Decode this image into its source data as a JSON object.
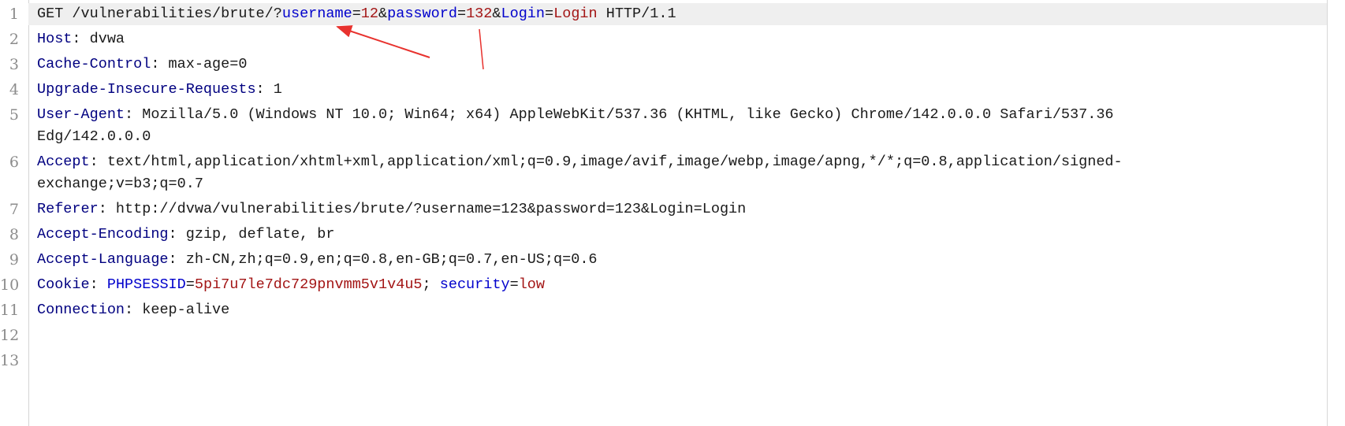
{
  "colors": {
    "header_name": "#000080",
    "param_name": "#0000cc",
    "param_value": "#a31515",
    "text": "#1a1a1a",
    "annotation": "#e8322e"
  },
  "active_line": 1,
  "lines": [
    {
      "n": "1",
      "segs": [
        [
          "t",
          "GET /vulnerabilities/brute/?"
        ],
        [
          "p",
          "username"
        ],
        [
          "t",
          "="
        ],
        [
          "v",
          "12"
        ],
        [
          "t",
          "&"
        ],
        [
          "p",
          "password"
        ],
        [
          "t",
          "="
        ],
        [
          "v",
          "132"
        ],
        [
          "t",
          "&"
        ],
        [
          "p",
          "Login"
        ],
        [
          "t",
          "="
        ],
        [
          "v",
          "Login"
        ],
        [
          "t",
          " HTTP/1.1"
        ]
      ]
    },
    {
      "n": "2",
      "segs": [
        [
          "k",
          "Host"
        ],
        [
          "t",
          ": dvwa"
        ]
      ]
    },
    {
      "n": "3",
      "segs": [
        [
          "k",
          "Cache-Control"
        ],
        [
          "t",
          ": max-age=0"
        ]
      ]
    },
    {
      "n": "4",
      "segs": [
        [
          "k",
          "Upgrade-Insecure-Requests"
        ],
        [
          "t",
          ": 1"
        ]
      ]
    },
    {
      "n": "5",
      "segs": [
        [
          "k",
          "User-Agent"
        ],
        [
          "t",
          ": Mozilla/5.0 (Windows NT 10.0; Win64; x64) AppleWebKit/537.36 (KHTML, like Gecko) Chrome/142.0.0.0 Safari/537.36 Edg/142.0.0.0"
        ]
      ]
    },
    {
      "n": "6",
      "segs": [
        [
          "k",
          "Accept"
        ],
        [
          "t",
          ": text/html,application/xhtml+xml,application/xml;q=0.9,image/avif,image/webp,image/apng,*/*;q=0.8,application/signed-exchange;v=b3;q=0.7"
        ]
      ]
    },
    {
      "n": "7",
      "segs": [
        [
          "k",
          "Referer"
        ],
        [
          "t",
          ": http://dvwa/vulnerabilities/brute/?username=123&password=123&Login=Login"
        ]
      ]
    },
    {
      "n": "8",
      "segs": [
        [
          "k",
          "Accept-Encoding"
        ],
        [
          "t",
          ": gzip, deflate, br"
        ]
      ]
    },
    {
      "n": "9",
      "segs": [
        [
          "k",
          "Accept-Language"
        ],
        [
          "t",
          ": zh-CN,zh;q=0.9,en;q=0.8,en-GB;q=0.7,en-US;q=0.6"
        ]
      ]
    },
    {
      "n": "10",
      "segs": [
        [
          "k",
          "Cookie"
        ],
        [
          "t",
          ": "
        ],
        [
          "p",
          "PHPSESSID"
        ],
        [
          "t",
          "="
        ],
        [
          "v",
          "5pi7u7le7dc729pnvmm5v1v4u5"
        ],
        [
          "t",
          "; "
        ],
        [
          "p",
          "security"
        ],
        [
          "t",
          "="
        ],
        [
          "v",
          "low"
        ]
      ]
    },
    {
      "n": "11",
      "segs": [
        [
          "k",
          "Connection"
        ],
        [
          "t",
          ": keep-alive"
        ]
      ]
    },
    {
      "n": "12",
      "segs": []
    },
    {
      "n": "13",
      "segs": []
    }
  ]
}
